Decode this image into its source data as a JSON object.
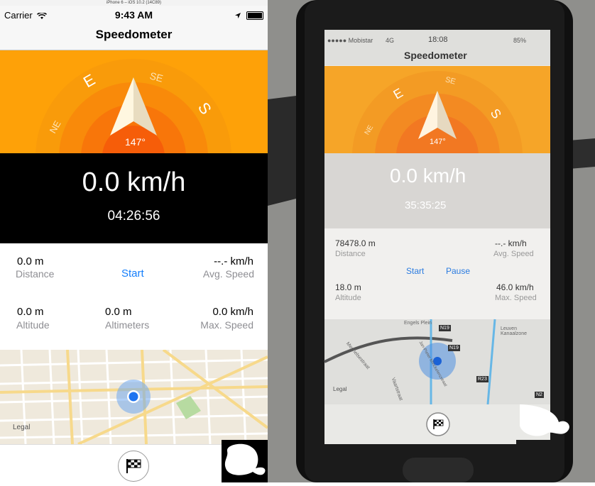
{
  "simulator": {
    "window_title": "iPhone 6 – iOS 10.2 (14C89)",
    "status": {
      "carrier": "Carrier",
      "time": "9:43 AM"
    },
    "nav_title": "Speedometer",
    "compass": {
      "heading": "147°",
      "labels": {
        "ne": "NE",
        "e": "E",
        "se": "SE",
        "s": "S"
      }
    },
    "speed": "0.0 km/h",
    "elapsed": "04:26:56",
    "stats": {
      "distance_value": "0.0 m",
      "distance_label": "Distance",
      "start_label": "Start",
      "avg_value": "--.- km/h",
      "avg_label": "Avg. Speed",
      "altitude_value": "0.0 m",
      "altitude_label": "Altitude",
      "altimeters_value": "0.0 m",
      "altimeters_label": "Altimeters",
      "max_value": "0.0 km/h",
      "max_label": "Max. Speed"
    },
    "map": {
      "legal": "Legal"
    },
    "colors": {
      "accent": "#fea108",
      "link": "#147efb",
      "dark": "#000000"
    }
  },
  "photo": {
    "status": {
      "carrier": "●●●●● Mobistar",
      "network": "4G",
      "time": "18:08",
      "battery": "85%"
    },
    "nav_title": "Speedometer",
    "compass": {
      "heading": "147°",
      "labels": {
        "ne": "NE",
        "e": "E",
        "se": "SE",
        "s": "S"
      }
    },
    "speed": "0.0 km/h",
    "elapsed": "35:35:25",
    "stats": {
      "distance_value": "78478.0 m",
      "distance_label": "Distance",
      "avg_value": "--.- km/h",
      "avg_label": "Avg. Speed",
      "start_label": "Start",
      "pause_label": "Pause",
      "altitude_value": "18.0 m",
      "altitude_label": "Altitude",
      "max_value": "46.0 km/h",
      "max_label": "Max. Speed"
    },
    "map": {
      "legal": "Legal",
      "streets": [
        "Engels Plein",
        "Mechelsestraat",
        "Vaartstraat",
        "Jan-Pieter Minckelersstraat",
        "Leuven Kanaalzone"
      ],
      "road_badges": [
        "N19",
        "N19",
        "R23",
        "N2"
      ]
    }
  }
}
